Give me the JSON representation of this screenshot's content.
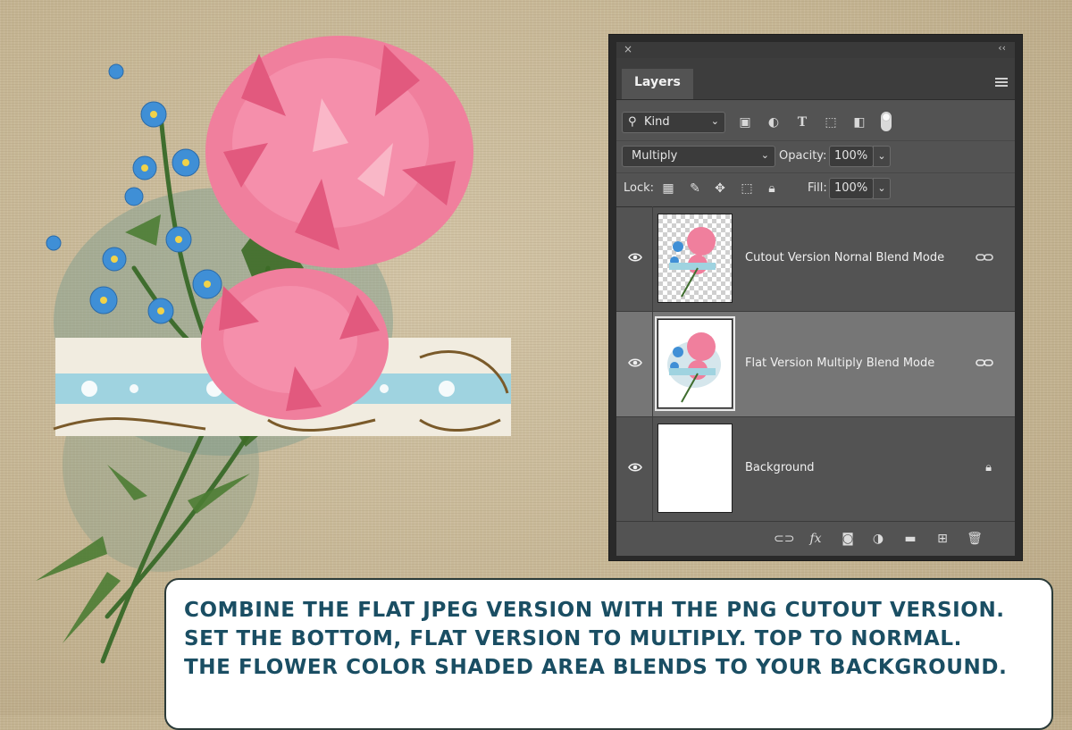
{
  "panel": {
    "close_glyph": "×",
    "collapse_glyph": "‹‹",
    "tab_label": "Layers",
    "filter": {
      "kind_label": "Kind"
    },
    "blend_mode": "Multiply",
    "opacity_label": "Opacity:",
    "opacity_value": "100%",
    "lock_label": "Lock:",
    "fill_label": "Fill:",
    "fill_value": "100%",
    "layers": [
      {
        "name": "Cutout Version Nornal Blend Mode",
        "selected": false,
        "badge": "link-icon"
      },
      {
        "name": "Flat Version Multiply Blend Mode",
        "selected": true,
        "badge": "link-icon"
      },
      {
        "name": "Background",
        "selected": false,
        "badge": "lock-icon"
      }
    ]
  },
  "caption": {
    "line1": "COMBINE THE FLAT JPEG VERSION WITH THE PNG CUTOUT VERSION.",
    "line2": "SET THE BOTTOM, FLAT VERSION TO MULTIPLY. TOP TO NORMAL.",
    "line3": "THE FLOWER COLOR SHADED AREA BLENDS TO YOUR BACKGROUND."
  },
  "colors": {
    "panel_bg": "#535353",
    "selected_row": "#767676",
    "caption_text": "#1a4e63",
    "canvas_bg": "#c5b593"
  }
}
